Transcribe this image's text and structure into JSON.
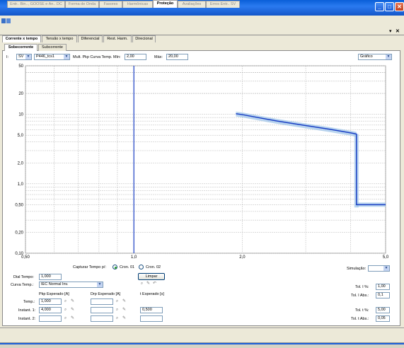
{
  "window": {
    "controls": {
      "minimize": "_",
      "maximize": "□",
      "close": "✕"
    }
  },
  "main_tabs": [
    {
      "label": "Entr.. Bin.., GOOSE e An.. DC",
      "active": false
    },
    {
      "label": "Forma de Onda",
      "active": false
    },
    {
      "label": "Fasores",
      "active": false
    },
    {
      "label": "Harmônicas",
      "active": false
    },
    {
      "label": "Proteção",
      "active": true
    },
    {
      "label": "Avaliações",
      "active": false
    },
    {
      "label": "Erros Entr.. SV",
      "active": false
    }
  ],
  "panel_controls": {
    "pin": "▾",
    "close": "✕"
  },
  "protection_tabs": [
    {
      "label": "Corrente x tempo",
      "active": true
    },
    {
      "label": "Tensão x tempo",
      "active": false
    },
    {
      "label": "Diferencial",
      "active": false
    },
    {
      "label": "Rest. Harm.",
      "active": false
    },
    {
      "label": "Direcional",
      "active": false
    }
  ],
  "sub_tabs": [
    {
      "label": "Sobecorrente",
      "active": true
    },
    {
      "label": "Subcorrente",
      "active": false
    }
  ],
  "controls": {
    "i_label": "I:",
    "source_select": "SV",
    "device_select": "P446_tcs1",
    "mult_label": "Mult. Pkp Curva Temp. Mín:",
    "mult_min_value": "2,00",
    "max_label": "Máx:",
    "mult_max_value": "20,00",
    "view_select": "Gráfico"
  },
  "chart_data": {
    "type": "line",
    "x_scale": "log",
    "y_scale": "log",
    "xlim": [
      0.5,
      5.0
    ],
    "ylim": [
      0.1,
      50
    ],
    "x_tick_labels": [
      "0,50",
      "1,0",
      "2,0",
      "5,0"
    ],
    "y_tick_labels": [
      "50",
      "20",
      "10",
      "5,0",
      "2,0",
      "1,0",
      "0,50",
      "0,20",
      "0,10"
    ],
    "grid": true,
    "vertical_marker_x": 1.0,
    "series": [
      {
        "x": [
          1.92,
          2.0,
          2.5,
          3.0,
          3.5,
          4.0,
          4.15,
          4.15,
          5.0
        ],
        "y": [
          10.2,
          9.9,
          8.0,
          6.9,
          6.1,
          5.4,
          5.2,
          0.5,
          0.5
        ]
      }
    ],
    "colors": {
      "curve": "#1a3fc4",
      "band": "#9dc3e8",
      "marker": "#1a3fc4",
      "grid": "#c0c0c0"
    }
  },
  "capture": {
    "label": "Capturar Tempo p/:",
    "option1": "Cron. 01",
    "option2": "Cron. 02",
    "clear_button": "Limpar",
    "simulation_label": "Simulação:",
    "simulation_value": ""
  },
  "settings": {
    "dial_label": "Dial Tempo:",
    "dial_value": "1,000",
    "curve_label": "Curva Temp.:",
    "curve_value": "IEC Normal Inv."
  },
  "table": {
    "headers": [
      "Pkp Esperado [A]",
      "Drp Esperado [A]",
      "t Esperado [s]"
    ],
    "rows": [
      {
        "label": "Temp.:",
        "pkp": "1,000",
        "drp": "",
        "t": ""
      },
      {
        "label": "Instant. 1:",
        "pkp": "4,000",
        "drp": "",
        "t": "0,500"
      },
      {
        "label": "Instant. 2:",
        "pkp": "",
        "drp": "",
        "t": ""
      }
    ]
  },
  "tolerances": [
    {
      "label": "Tol. I %:",
      "value": "1,00"
    },
    {
      "label": "Tol. I Abs.:",
      "value": "0,1"
    },
    {
      "label": "Tol. t %:",
      "value": "5,00"
    },
    {
      "label": "Tol. t Abs.:",
      "value": "0,05"
    }
  ]
}
